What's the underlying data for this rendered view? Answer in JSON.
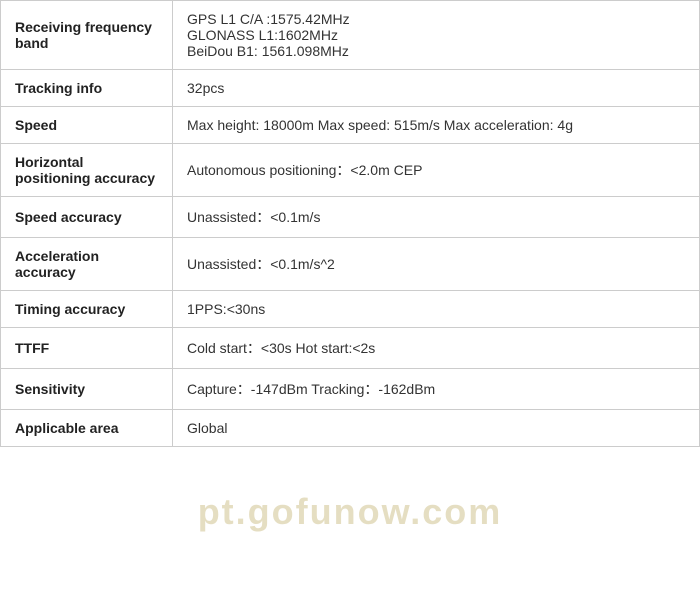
{
  "table": {
    "rows": [
      {
        "label": "Receiving frequency band",
        "value": "GPS L1 C/A :1575.42MHz\nGLONASS L1:1602MHz\nBeiDou B1: 1561.098MHz"
      },
      {
        "label": "Tracking info",
        "value": "32pcs"
      },
      {
        "label": "Speed",
        "value": "Max height:  18000m  Max speed:  515m/s  Max acceleration:  4g"
      },
      {
        "label": "Horizontal positioning accuracy",
        "value": "Autonomous positioning：<2.0m CEP"
      },
      {
        "label": "Speed accuracy",
        "value": "Unassisted：<0.1m/s"
      },
      {
        "label": "Acceleration accuracy",
        "value": "Unassisted：<0.1m/s^2"
      },
      {
        "label": "Timing accuracy",
        "value": "1PPS:<30ns"
      },
      {
        "label": "TTFF",
        "value": "Cold start：<30s  Hot start:<2s"
      },
      {
        "label": "Sensitivity",
        "value": "Capture：-147dBm  Tracking：-162dBm"
      },
      {
        "label": "Applicable area",
        "value": "Global"
      }
    ]
  },
  "watermark": "pt.gofunow.com"
}
